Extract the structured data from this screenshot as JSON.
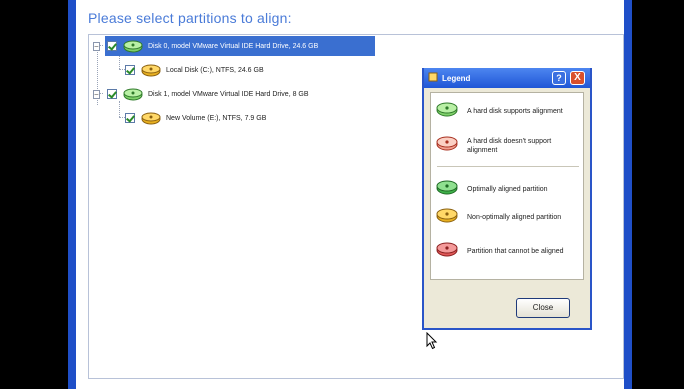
{
  "heading": "Please select partitions to align:",
  "tree": {
    "rows": [
      {
        "label": "Disk 0, model VMware Virtual IDE Hard Drive, 24.6 GB",
        "icon": "green-disk-icon",
        "selected": true
      },
      {
        "label": "Local Disk (C:), NTFS, 24.6 GB",
        "icon": "yellow-partition-icon",
        "selected": false
      },
      {
        "label": "Disk 1, model VMware Virtual IDE Hard Drive, 8 GB",
        "icon": "green-disk-icon",
        "selected": false
      },
      {
        "label": "New Volume (E:), NTFS, 7.9 GB",
        "icon": "yellow-partition-icon",
        "selected": false
      }
    ]
  },
  "legend": {
    "title": "Legend",
    "help_label": "?",
    "close_x_label": "X",
    "items": [
      {
        "label": "A hard disk supports alignment",
        "icon": "green-disk-icon"
      },
      {
        "label": "A hard disk doesn't support alignment",
        "icon": "red-disk-icon"
      },
      {
        "label": "Optimally aligned partition",
        "icon": "green-partition-icon"
      },
      {
        "label": "Non-optimally aligned partition",
        "icon": "yellow-partition-icon"
      },
      {
        "label": "Partition that cannot be aligned",
        "icon": "red-partition-icon"
      }
    ],
    "close_button_label": "Close"
  },
  "colors": {
    "selection": "#3a6fd0",
    "heading": "#4a7bd8",
    "title_bar": "#1f56d6",
    "dialog_face": "#ece9d8"
  }
}
